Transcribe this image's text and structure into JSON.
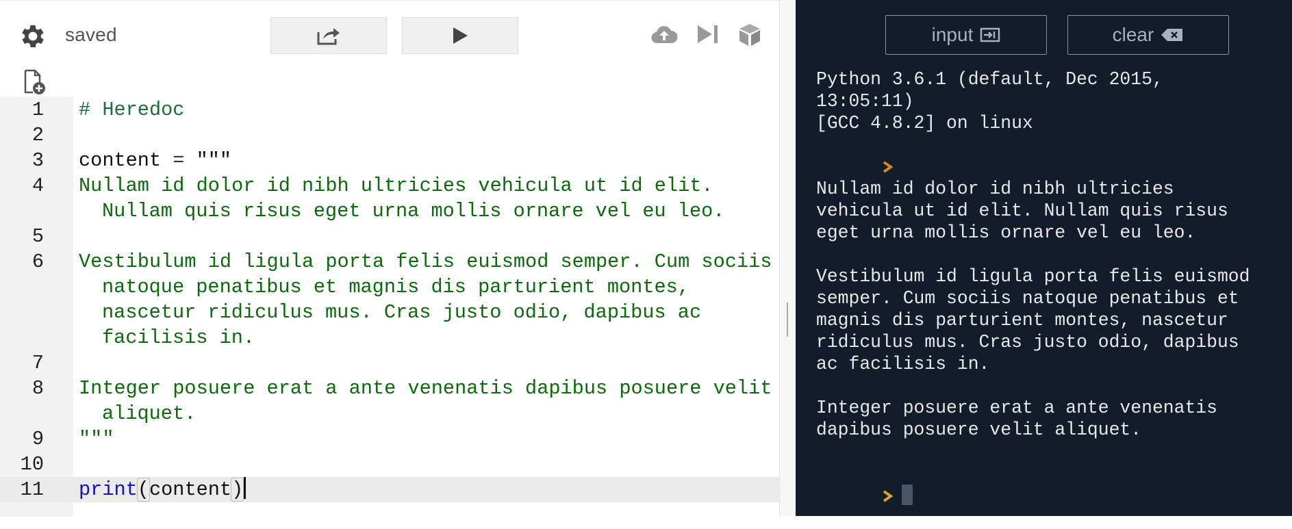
{
  "editor": {
    "status": "saved",
    "lines": [
      {
        "n": "1",
        "segments": [
          {
            "t": "# Heredoc",
            "c": "c-comment"
          }
        ]
      },
      {
        "n": "2",
        "segments": []
      },
      {
        "n": "3",
        "segments": [
          {
            "t": "content",
            "c": "c-ident"
          },
          {
            "t": " = ",
            "c": "c-op"
          },
          {
            "t": "\"\"\"",
            "c": "c-ident"
          }
        ]
      },
      {
        "n": "4",
        "segments": [
          {
            "t": "Nullam id dolor id nibh ultricies vehicula ut id elit.",
            "c": "c-string"
          }
        ]
      },
      {
        "n": "",
        "cont": true,
        "segments": [
          {
            "t": "Nullam quis risus eget urna mollis ornare vel eu leo.",
            "c": "c-string"
          }
        ]
      },
      {
        "n": "5",
        "segments": []
      },
      {
        "n": "6",
        "segments": [
          {
            "t": "Vestibulum id ligula porta felis euismod semper. Cum sociis",
            "c": "c-string"
          }
        ]
      },
      {
        "n": "",
        "cont": true,
        "segments": [
          {
            "t": "natoque penatibus et magnis dis parturient montes,",
            "c": "c-string"
          }
        ]
      },
      {
        "n": "",
        "cont": true,
        "segments": [
          {
            "t": "nascetur ridiculus mus. Cras justo odio, dapibus ac",
            "c": "c-string"
          }
        ]
      },
      {
        "n": "",
        "cont": true,
        "segments": [
          {
            "t": "facilisis in.",
            "c": "c-string"
          }
        ]
      },
      {
        "n": "7",
        "segments": []
      },
      {
        "n": "8",
        "segments": [
          {
            "t": "Integer posuere erat a ante venenatis dapibus posuere velit",
            "c": "c-string"
          }
        ]
      },
      {
        "n": "",
        "cont": true,
        "segments": [
          {
            "t": "aliquet.",
            "c": "c-string"
          }
        ]
      },
      {
        "n": "9",
        "segments": [
          {
            "t": "\"\"\"",
            "c": "c-string"
          }
        ]
      },
      {
        "n": "10",
        "segments": []
      },
      {
        "n": "11",
        "active": true,
        "segments": [
          {
            "t": "print",
            "c": "c-kw"
          },
          {
            "t": "(",
            "c": "c-ident paren-match"
          },
          {
            "t": "content",
            "c": "c-ident"
          },
          {
            "t": ")",
            "c": "c-ident paren-match"
          }
        ],
        "cursor": true
      }
    ]
  },
  "console": {
    "input_label": "input",
    "clear_label": "clear",
    "header_lines": [
      "Python 3.6.1 (default, Dec 2015,",
      "13:05:11)",
      "[GCC 4.8.2] on linux"
    ],
    "output_lines": [
      "Nullam id dolor id nibh ultricies",
      "vehicula ut id elit. Nullam quis risus",
      "eget urna mollis ornare vel eu leo.",
      "",
      "Vestibulum id ligula porta felis euismod",
      "semper. Cum sociis natoque penatibus et",
      "magnis dis parturient montes, nascetur",
      "ridiculus mus. Cras justo odio, dapibus",
      "ac facilisis in.",
      "",
      "Integer posuere erat a ante venenatis",
      "dapibus posuere velit aliquet.",
      ""
    ]
  },
  "colors": {
    "console_bg": "#121c2b",
    "prompt": "#e0a020",
    "string": "#0b6b0b",
    "keyword": "#1010c8"
  }
}
